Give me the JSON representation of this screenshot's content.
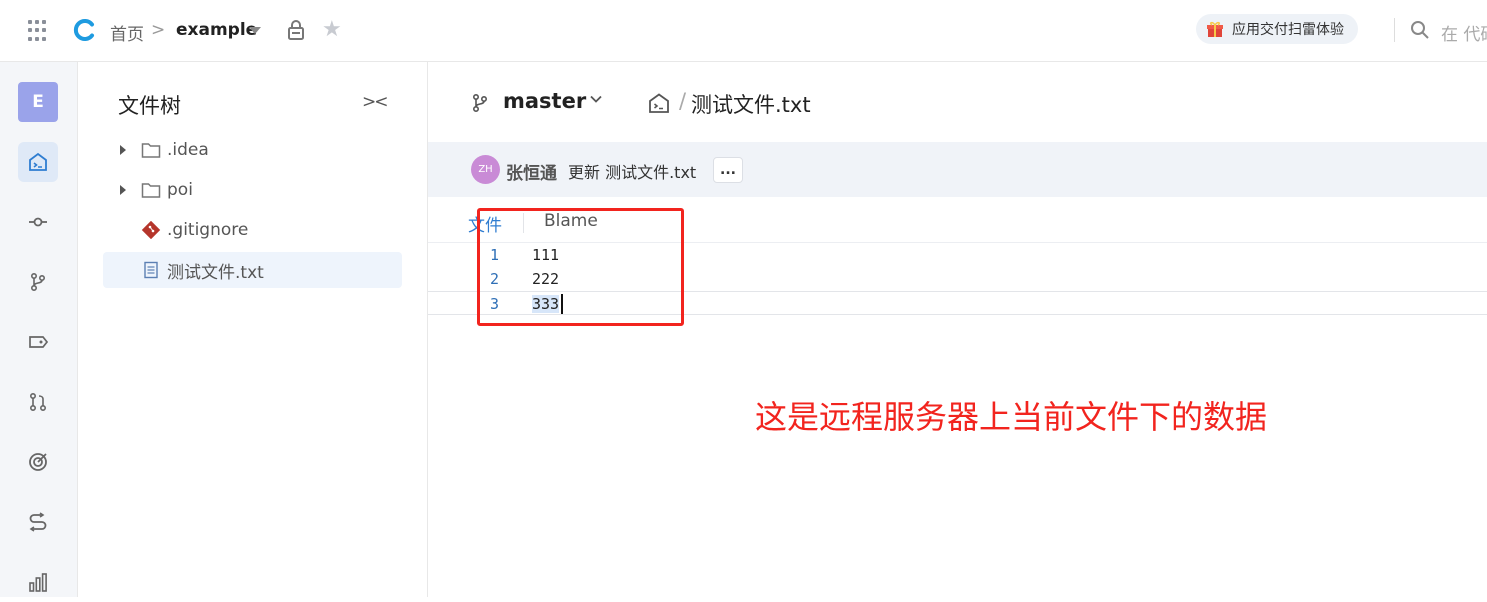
{
  "topbar": {
    "home": "首页",
    "separator": ">",
    "repo": "example",
    "promo": "应用交付扫雷体验",
    "search_placeholder": "在 代码"
  },
  "rail": {
    "avatar_letter": "E",
    "icons": [
      "code-icon",
      "commit-icon",
      "branch-icon",
      "tag-icon",
      "pull-request-icon",
      "target-icon",
      "pipeline-icon",
      "stats-icon"
    ]
  },
  "tree": {
    "title": "文件树",
    "collapse": "><",
    "items": [
      {
        "label": ".idea",
        "type": "folder"
      },
      {
        "label": "poi",
        "type": "folder"
      },
      {
        "label": ".gitignore",
        "type": "git"
      },
      {
        "label": "测试文件.txt",
        "type": "file"
      }
    ]
  },
  "main": {
    "branch": "master",
    "path_separator": "/",
    "file": "测试文件.txt",
    "commit": {
      "avatar_initials": "ZH",
      "author": "张恒通",
      "message": "更新 测试文件.txt",
      "more": "..."
    },
    "tabs": {
      "file": "文件",
      "blame": "Blame"
    },
    "lines": [
      {
        "num": "1",
        "text": "111"
      },
      {
        "num": "2",
        "text": "222"
      },
      {
        "num": "3",
        "text": "333"
      }
    ],
    "annotation": "这是远程服务器上当前文件下的数据"
  },
  "colors": {
    "accent": "#2f7dd1",
    "annotation": "#f2241e",
    "avatar": "#9aa3ea"
  }
}
